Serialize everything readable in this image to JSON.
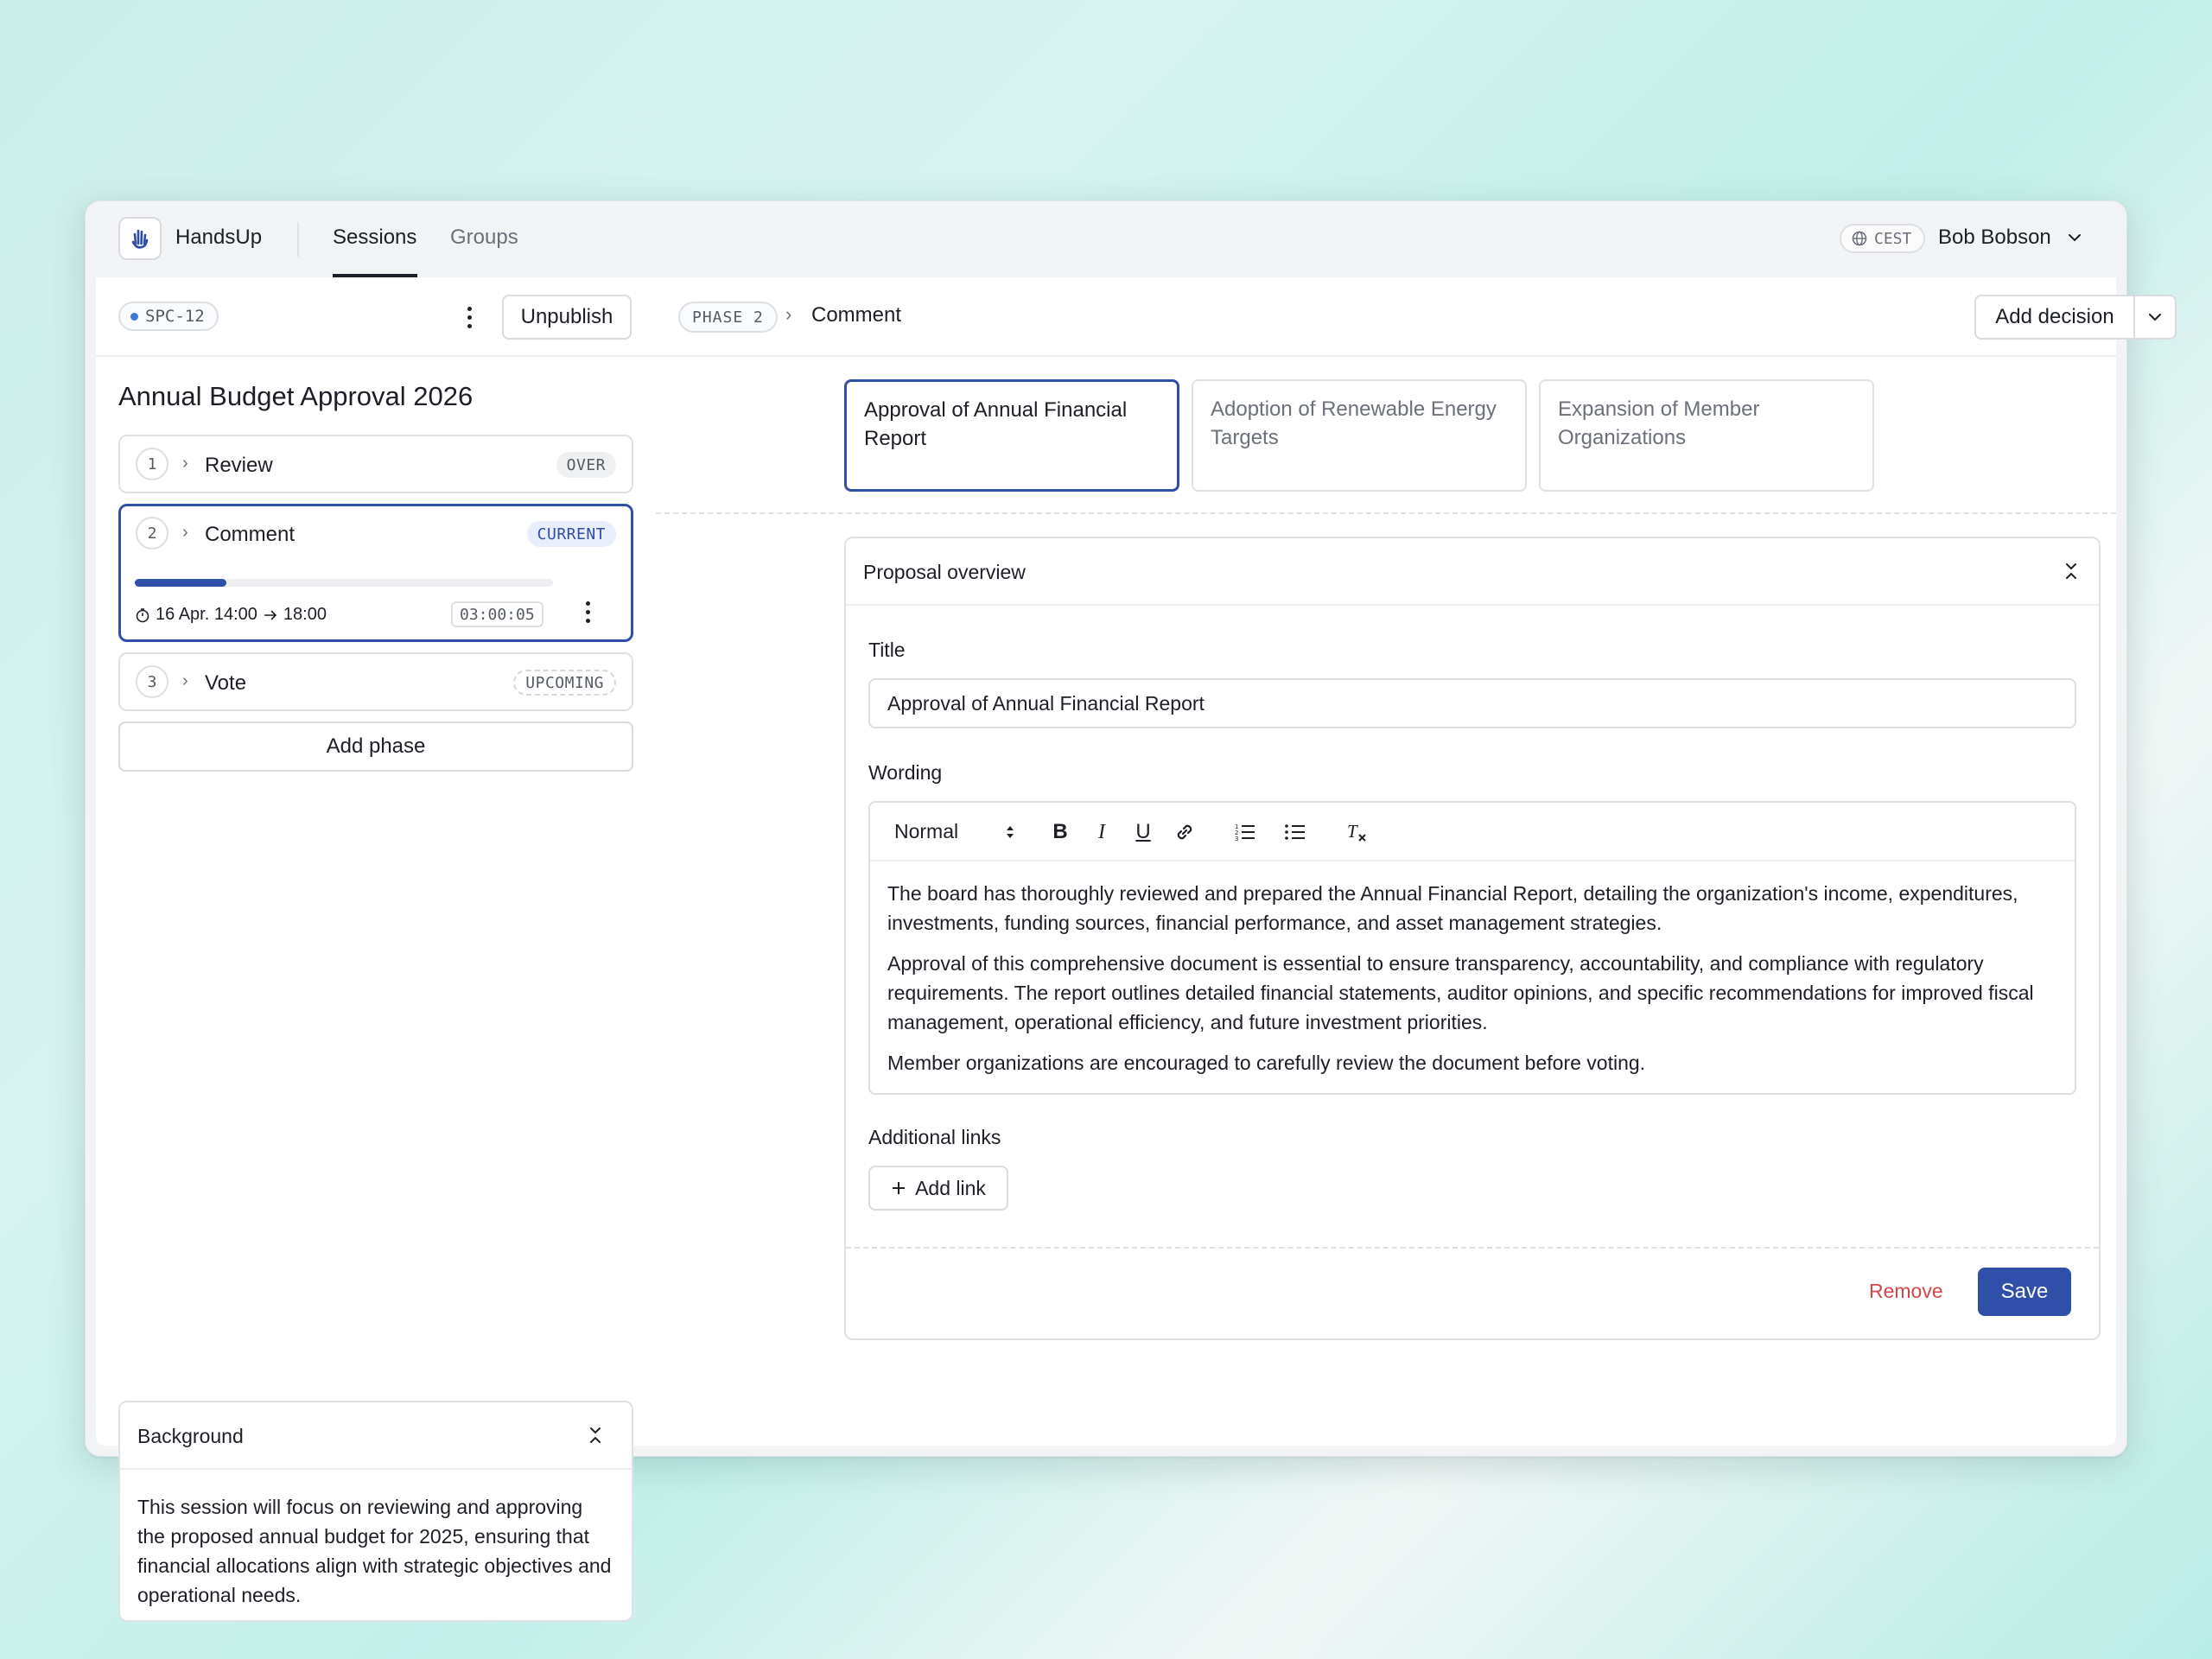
{
  "app": {
    "name": "HandsUp",
    "logo_icon": "raised-hand-icon"
  },
  "nav": {
    "tabs": [
      {
        "label": "Sessions",
        "active": true
      },
      {
        "label": "Groups",
        "active": false
      }
    ]
  },
  "header": {
    "timezone": "CEST",
    "user_name": "Bob Bobson"
  },
  "session": {
    "id": "SPC-12",
    "unpublish_label": "Unpublish",
    "title": "Annual Budget Approval 2026",
    "phases": [
      {
        "number": "1",
        "name": "Review",
        "status": "OVER"
      },
      {
        "number": "2",
        "name": "Comment",
        "status": "CURRENT",
        "progress": 0.22,
        "schedule_start": "16 Apr. 14:00",
        "schedule_end": "18:00",
        "timer": "03:00:05"
      },
      {
        "number": "3",
        "name": "Vote",
        "status": "UPCOMING"
      }
    ],
    "add_phase_label": "Add phase",
    "background": {
      "title": "Background",
      "text": "This session will focus on reviewing and approving the proposed annual budget for 2025, ensuring that financial allocations align with strategic objectives and operational needs."
    }
  },
  "main": {
    "phase_badge": "PHASE 2",
    "breadcrumb_current": "Comment",
    "add_decision_label": "Add decision",
    "decisions": [
      {
        "label": "Approval of Annual Financial Report",
        "active": true
      },
      {
        "label": "Adoption of Renewable Energy Targets",
        "active": false
      },
      {
        "label": "Expansion of Member Organizations",
        "active": false
      }
    ],
    "overview": {
      "heading": "Proposal overview",
      "title_label": "Title",
      "title_value": "Approval of Annual Financial Report",
      "wording_label": "Wording",
      "format_select": "Normal",
      "paragraphs": [
        "The board has thoroughly reviewed and prepared the Annual Financial Report, detailing the organization's income, expenditures, investments, funding sources, financial performance, and asset management strategies.",
        "Approval of this comprehensive document is essential to ensure transparency, accountability, and compliance with regulatory requirements. The report outlines detailed financial statements, auditor opinions, and specific recommendations for improved fiscal management, operational efficiency, and future investment priorities.",
        "Member organizations are encouraged to carefully review the document before voting."
      ],
      "links_label": "Additional links",
      "add_link_label": "Add link",
      "remove_label": "Remove",
      "save_label": "Save"
    }
  },
  "colors": {
    "accent": "#2f4fa8",
    "danger": "#d0464b",
    "id_dot": "#3b78d8"
  }
}
